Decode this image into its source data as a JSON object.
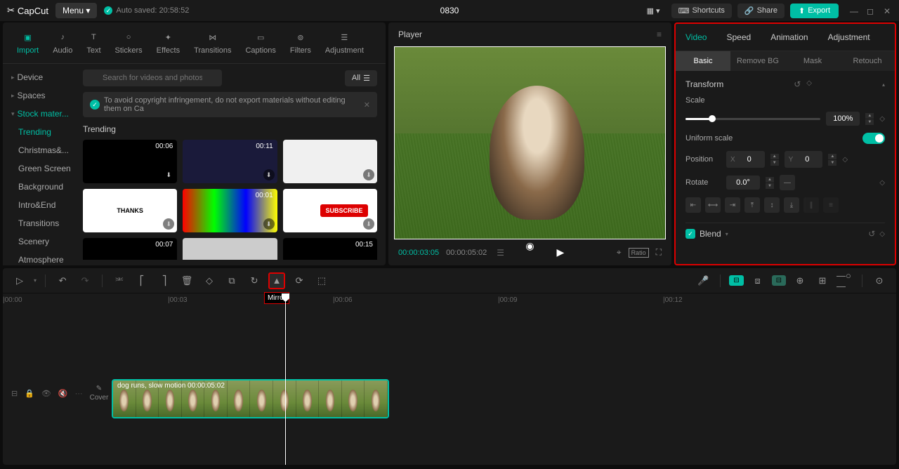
{
  "app": {
    "name": "CapCut",
    "menu": "Menu",
    "autosave": "Auto saved: 20:58:52",
    "project": "0830"
  },
  "topbar": {
    "shortcuts": "Shortcuts",
    "share": "Share",
    "export": "Export"
  },
  "tools": [
    {
      "label": "Import",
      "active": true
    },
    {
      "label": "Audio"
    },
    {
      "label": "Text"
    },
    {
      "label": "Stickers"
    },
    {
      "label": "Effects"
    },
    {
      "label": "Transitions"
    },
    {
      "label": "Captions"
    },
    {
      "label": "Filters"
    },
    {
      "label": "Adjustment"
    }
  ],
  "sidebar": [
    {
      "label": "Device",
      "type": "expandable"
    },
    {
      "label": "Spaces",
      "type": "expandable"
    },
    {
      "label": "Stock mater...",
      "type": "expanded",
      "active": true
    },
    {
      "label": "Trending",
      "type": "sub",
      "active": true
    },
    {
      "label": "Christmas&...",
      "type": "sub"
    },
    {
      "label": "Green Screen",
      "type": "sub"
    },
    {
      "label": "Background",
      "type": "sub"
    },
    {
      "label": "Intro&End",
      "type": "sub"
    },
    {
      "label": "Transitions",
      "type": "sub"
    },
    {
      "label": "Scenery",
      "type": "sub"
    },
    {
      "label": "Atmosphere",
      "type": "sub"
    }
  ],
  "search": {
    "placeholder": "Search for videos and photos",
    "filter": "All"
  },
  "notice": "To avoid copyright infringement, do not export materials without editing them on Ca",
  "section": "Trending",
  "media": [
    {
      "dur": "00:06"
    },
    {
      "dur": "00:11"
    },
    {
      "dur": ""
    },
    {
      "dur": ""
    },
    {
      "dur": "00:01"
    },
    {
      "dur": ""
    },
    {
      "dur": "00:07"
    },
    {
      "dur": ""
    },
    {
      "dur": "00:15"
    }
  ],
  "player": {
    "title": "Player",
    "current": "00:00:03:05",
    "total": "00:00:05:02",
    "ratio": "Ratio"
  },
  "props": {
    "tabs": [
      "Video",
      "Speed",
      "Animation",
      "Adjustment"
    ],
    "subtabs": [
      "Basic",
      "Remove BG",
      "Mask",
      "Retouch"
    ],
    "transform": "Transform",
    "scale": {
      "label": "Scale",
      "value": "100%"
    },
    "uniform": "Uniform scale",
    "position": {
      "label": "Position",
      "x": "0",
      "y": "0",
      "xl": "X",
      "yl": "Y"
    },
    "rotate": {
      "label": "Rotate",
      "value": "0.0°"
    },
    "blend": "Blend"
  },
  "timeline": {
    "mirror_tooltip": "Mirror",
    "ruler": [
      "|00:00",
      "|00:03",
      "|00:06",
      "|00:09",
      "|00:12"
    ],
    "clip": {
      "label": "dog runs, slow motion  00:00:05:02"
    },
    "cover": "Cover"
  }
}
